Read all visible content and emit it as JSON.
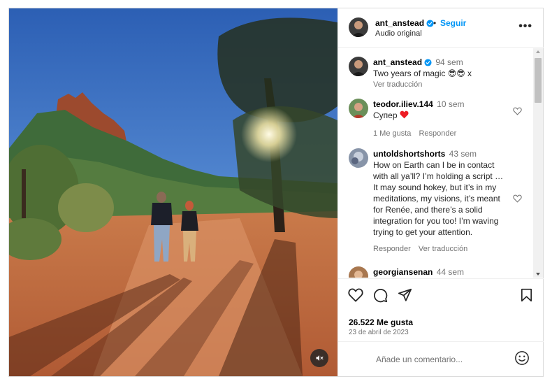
{
  "header": {
    "username": "ant_anstead",
    "separator": "•",
    "follow_label": "Seguir",
    "audio_label": "Audio original",
    "more_label": "•••"
  },
  "comments": [
    {
      "username": "ant_anstead",
      "time": "94 sem",
      "text": "Two years of magic 😎😎 x",
      "translate": "Ver traducción"
    },
    {
      "username": "teodor.iliev.144",
      "time": "10 sem",
      "text": "Супер",
      "likes": "1 Me gusta",
      "reply": "Responder"
    },
    {
      "username": "untoldshortshorts",
      "time": "43 sem",
      "text": "How on Earth can I be in contact with all ya’ll? I’m holding a script … It may sound hokey, but it’s in my meditations, my visions, it’s meant for Renée, and there’s a solid integration for you too! I’m waving trying to get your attention.",
      "reply": "Responder",
      "translate": "Ver traducción"
    },
    {
      "username": "georgiansenan",
      "time": "44 sem"
    }
  ],
  "actions": {
    "like_icon": "heart-outline-icon",
    "comment_icon": "comment-bubble-icon",
    "share_icon": "paper-plane-icon",
    "save_icon": "bookmark-icon"
  },
  "likes_count": "26.522 Me gusta",
  "date": "23 de abril de 2023",
  "comment_box": {
    "placeholder": "Añade un comentario...",
    "emoji_icon": "smiley-icon"
  },
  "colors": {
    "link_blue": "#0095f6",
    "verified_blue": "#0095f6",
    "muted_text": "#737373",
    "heart_red": "#ed1c24"
  },
  "media": {
    "mute_icon": "speaker-muted-icon"
  }
}
